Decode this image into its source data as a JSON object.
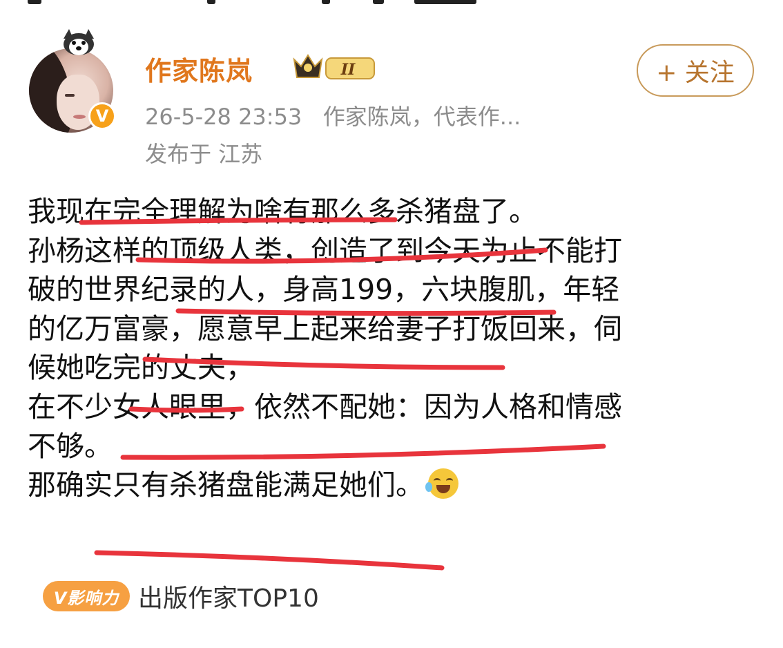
{
  "post": {
    "author_name": "作家陈岚",
    "level_badge": "II",
    "follow_label": "+ 关注",
    "timestamp": "26-5-28 23:53",
    "bio_snippet": "作家陈岚，代表作...",
    "location": "发布于 江苏",
    "verified_mark": "V",
    "lines": [
      "我现在完全理解为啥有那么多杀猪盘了。",
      "孙杨这样的顶级人类，创造了到今天为止不能打",
      "破的世界纪录的人，身高199，六块腹肌，年轻",
      "的亿万富豪，愿意早上起来给妻子打饭回来，伺",
      "候她吃完的丈夫，",
      "在不少女人眼里，依然不配她：因为人格和情感",
      "不够。",
      "那确实只有杀猪盘能满足她们。"
    ],
    "emoji": "laugh-cry-emoji",
    "influence_badge": "V影响力",
    "influence_text": "出版作家TOP10"
  },
  "colors": {
    "author": "#e0771d",
    "follow_border": "#c89a5a",
    "underline": "#e8343c",
    "meta": "#8c8c8c",
    "badge": "#f6a042"
  }
}
